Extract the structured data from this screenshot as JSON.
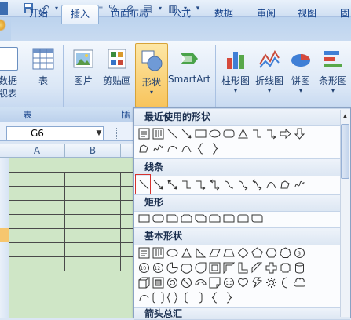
{
  "qat": {
    "icons": [
      "save-icon",
      "undo-icon",
      "redo-icon",
      "fx-icon",
      "percent-icon",
      "edit-icon",
      "table-icon",
      "customize-icon"
    ]
  },
  "tabs": [
    {
      "label": "开始"
    },
    {
      "label": "插入",
      "active": true
    },
    {
      "label": "页面布局"
    },
    {
      "label": "公式"
    },
    {
      "label": "数据"
    },
    {
      "label": "审阅"
    },
    {
      "label": "视图"
    },
    {
      "label": "固"
    }
  ],
  "ribbon": {
    "pivot_label_1": "数据",
    "pivot_label_2": "视表",
    "table_label": "表",
    "picture_label": "图片",
    "clipart_label": "剪贴画",
    "shapes_label": "形状",
    "smartart_label": "SmartArt",
    "column_chart_label": "柱形图",
    "line_chart_label": "折线图",
    "pie_chart_label": "饼图",
    "bar_chart_label": "条形图",
    "group_tables": "表",
    "group_illustrations": "插"
  },
  "formula_bar": {
    "name_box": "G6"
  },
  "grid": {
    "columns": [
      "A",
      "B"
    ]
  },
  "dropdown": {
    "recent": "最近使用的形状",
    "lines": "线条",
    "rect": "矩形",
    "basic": "基本形状",
    "arrows": "箭头总汇"
  }
}
